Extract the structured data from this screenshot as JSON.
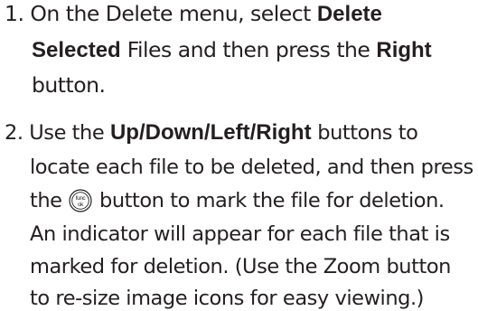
{
  "steps": [
    {
      "number": "1.",
      "lines": [
        [
          {
            "t": " On the Delete menu, select ",
            "b": false
          },
          {
            "t": "Delete",
            "b": true
          }
        ],
        [
          {
            "t": "Selected",
            "b": true
          },
          {
            "t": " Files and then press the ",
            "b": false
          },
          {
            "t": "Right",
            "b": true
          }
        ],
        [
          {
            "t": "button.",
            "b": false
          }
        ]
      ]
    },
    {
      "number": "2.",
      "lines": [
        [
          {
            "t": " Use the ",
            "b": false
          },
          {
            "t": "Up/Down/Left/Right",
            "b": true
          },
          {
            "t": " buttons to",
            "b": false
          }
        ],
        [
          {
            "t": "locate each file to be deleted, and then press",
            "b": false
          }
        ],
        [
          {
            "t": "the ",
            "b": false
          },
          {
            "icon": "func-ok-button-icon"
          },
          {
            "t": " button to mark the file for deletion.",
            "b": false
          }
        ],
        [
          {
            "t": "An indicator will appear for each file that is",
            "b": false
          }
        ],
        [
          {
            "t": "marked for deletion.  (Use the Zoom button",
            "b": false
          }
        ],
        [
          {
            "t": "to re-size image icons for easy viewing.)",
            "b": false
          }
        ]
      ]
    }
  ],
  "icons": {
    "func_ok": {
      "top_label": "func",
      "bottom_label": "ok",
      "name": "func-ok-button-icon"
    }
  },
  "colors": {
    "text": "#231f20",
    "background": "#ffffff"
  }
}
